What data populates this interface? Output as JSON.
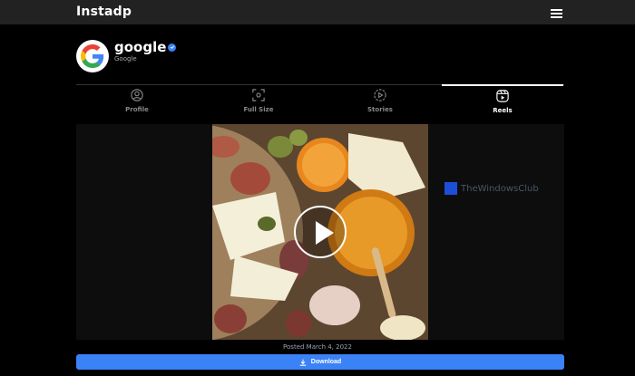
{
  "header": {
    "brand": "Instadp",
    "menu_icon": "hamburger-menu-icon"
  },
  "profile": {
    "username": "google",
    "display_name": "Google",
    "verified": true,
    "avatar_icon": "google-logo-icon"
  },
  "tabs": [
    {
      "label": "Profile",
      "icon": "user-circle-icon",
      "active": false
    },
    {
      "label": "Full Size",
      "icon": "expand-frame-icon",
      "active": false
    },
    {
      "label": "Stories",
      "icon": "stories-play-icon",
      "active": false
    },
    {
      "label": "Reels",
      "icon": "reels-icon",
      "active": true
    }
  ],
  "media": {
    "play_icon": "play-button-icon",
    "watermark": "TheWindowsClub"
  },
  "posted": "Posted March 4, 2022",
  "download": {
    "label": "Download",
    "icon": "download-icon"
  },
  "colors": {
    "accent": "#3b82f6",
    "topbar": "#222222",
    "background": "#000000"
  }
}
